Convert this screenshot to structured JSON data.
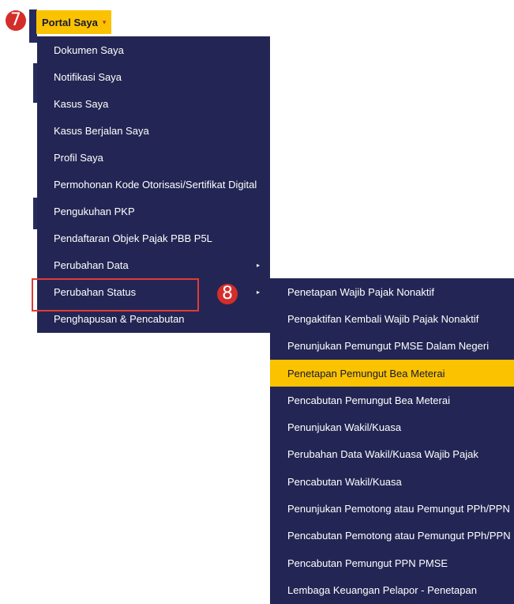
{
  "badges": {
    "step7": "7",
    "step8": "8"
  },
  "portal": {
    "label": "Portal Saya",
    "caret": "▾"
  },
  "main_menu": {
    "items": [
      {
        "label": "Dokumen Saya"
      },
      {
        "label": "Notifikasi Saya"
      },
      {
        "label": "Kasus Saya"
      },
      {
        "label": "Kasus Berjalan Saya"
      },
      {
        "label": "Profil Saya"
      },
      {
        "label": "Permohonan Kode Otorisasi/Sertifikat Digital"
      },
      {
        "label": "Pengukuhan PKP"
      },
      {
        "label": "Pendaftaran Objek Pajak PBB P5L"
      },
      {
        "label": "Perubahan Data",
        "submenu_arrow": "▸"
      },
      {
        "label": "Perubahan Status",
        "submenu_arrow": "▸"
      },
      {
        "label": "Penghapusan & Pencabutan"
      }
    ]
  },
  "sub_menu": {
    "items": [
      {
        "label": "Penetapan Wajib Pajak Nonaktif"
      },
      {
        "label": "Pengaktifan Kembali Wajib Pajak Nonaktif"
      },
      {
        "label": "Penunjukan Pemungut PMSE Dalam Negeri"
      },
      {
        "label": "Penetapan Pemungut Bea Meterai",
        "active": true
      },
      {
        "label": "Pencabutan Pemungut Bea Meterai"
      },
      {
        "label": "Penunjukan Wakil/Kuasa"
      },
      {
        "label": "Perubahan Data Wakil/Kuasa Wajib Pajak"
      },
      {
        "label": "Pencabutan Wakil/Kuasa"
      },
      {
        "label": "Penunjukan Pemotong atau Pemungut PPh/PPN"
      },
      {
        "label": "Pencabutan Pemotong atau Pemungut PPh/PPN"
      },
      {
        "label": "Pencabutan Pemungut PPN PMSE"
      },
      {
        "label": "Lembaga Keuangan Pelapor - Penetapan"
      }
    ]
  },
  "colors": {
    "navy": "#232654",
    "accent": "#fbc200",
    "badge_red": "#d42e2a",
    "highlight_border": "#e03b34"
  }
}
